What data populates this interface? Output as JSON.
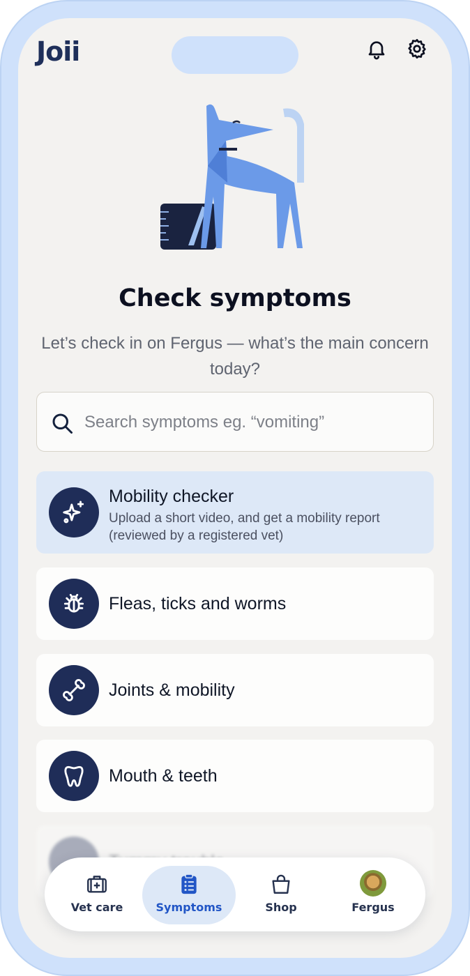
{
  "app": {
    "logo": "Joii"
  },
  "header": {
    "bell_icon": "bell-icon",
    "settings_icon": "gear-icon"
  },
  "hero": {
    "illustration": "dog-illustration"
  },
  "main": {
    "title": "Check symptoms",
    "subtitle": "Let’s check in on Fergus — what’s the main concern today?"
  },
  "search": {
    "placeholder": "Search symptoms eg. “vomiting”",
    "icon": "search-icon"
  },
  "categories": [
    {
      "title": "Mobility checker",
      "description": "Upload a short video, and get a mobility report (reviewed by a registered vet)",
      "icon": "sparkle-icon"
    },
    {
      "title": "Fleas, ticks and worms",
      "icon": "bug-icon"
    },
    {
      "title": "Joints & mobility",
      "icon": "bone-icon"
    },
    {
      "title": "Mouth & teeth",
      "icon": "tooth-icon"
    },
    {
      "title": "Tummy trouble",
      "icon": "tummy-icon"
    }
  ],
  "nav": {
    "items": [
      {
        "label": "Vet care",
        "icon": "first-aid-kit-icon"
      },
      {
        "label": "Symptoms",
        "icon": "clipboard-icon",
        "active": true
      },
      {
        "label": "Shop",
        "icon": "shopping-bag-icon"
      },
      {
        "label": "Fergus",
        "icon": "pet-avatar"
      }
    ]
  },
  "colors": {
    "accent": "#2256c6",
    "navy": "#1f2d58",
    "frame": "#cfe1fb",
    "highlight": "#dde8f7"
  }
}
